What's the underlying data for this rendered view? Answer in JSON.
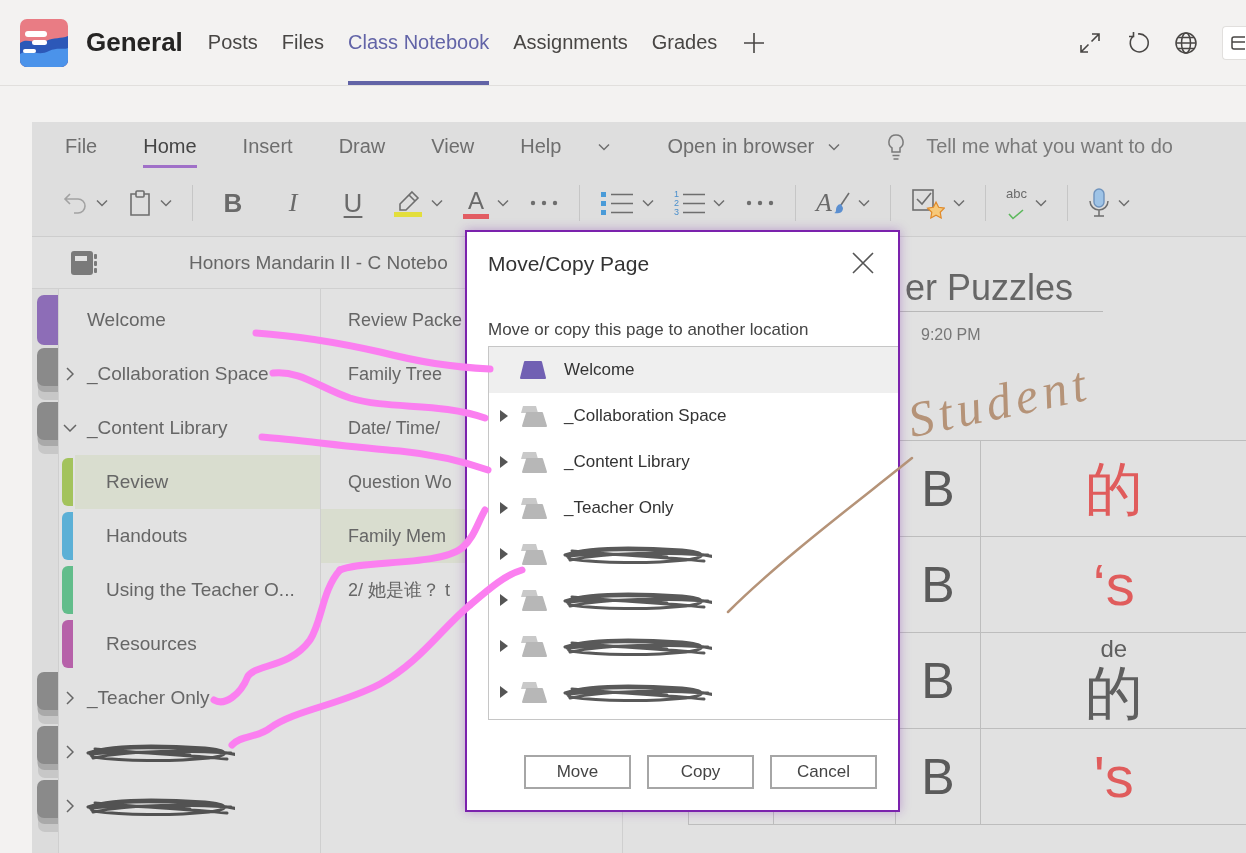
{
  "app_bar": {
    "team_name": "General",
    "tabs": [
      {
        "label": "Posts",
        "selected": false
      },
      {
        "label": "Files",
        "selected": false
      },
      {
        "label": "Class Notebook",
        "selected": true
      },
      {
        "label": "Assignments",
        "selected": false
      },
      {
        "label": "Grades",
        "selected": false
      }
    ]
  },
  "ribbon": {
    "tabs": [
      {
        "label": "File",
        "selected": false
      },
      {
        "label": "Home",
        "selected": true
      },
      {
        "label": "Insert",
        "selected": false
      },
      {
        "label": "Draw",
        "selected": false
      },
      {
        "label": "View",
        "selected": false
      },
      {
        "label": "Help",
        "selected": false
      }
    ],
    "open_in_browser": "Open in browser",
    "search": {
      "placeholder": "Tell me what you want to do"
    },
    "tools": [
      {
        "kind": "undo",
        "menu": true
      },
      {
        "kind": "paste",
        "menu": true
      },
      {
        "kind": "separator"
      },
      {
        "kind": "bold",
        "label": "B",
        "menu": false
      },
      {
        "kind": "italic",
        "label": "I",
        "menu": false
      },
      {
        "kind": "underline",
        "label": "U",
        "menu": false
      },
      {
        "kind": "highlight",
        "menu": true
      },
      {
        "kind": "font-color",
        "label": "A",
        "menu": true
      },
      {
        "kind": "more",
        "menu": false
      },
      {
        "kind": "separator"
      },
      {
        "kind": "bullets",
        "menu": true
      },
      {
        "kind": "numbering",
        "digits": [
          "1",
          "2",
          "3"
        ],
        "menu": true
      },
      {
        "kind": "more",
        "menu": false
      },
      {
        "kind": "separator"
      },
      {
        "kind": "styles",
        "label": "A",
        "menu": true
      },
      {
        "kind": "separator"
      },
      {
        "kind": "tag",
        "menu": true
      },
      {
        "kind": "separator"
      },
      {
        "kind": "spelling",
        "label": "abc",
        "menu": true
      },
      {
        "kind": "separator"
      },
      {
        "kind": "dictate",
        "menu": true
      }
    ]
  },
  "notebook": {
    "title": "Honors Mandarin II - C Notebo",
    "sections": [
      {
        "kind": "section",
        "label": "Welcome",
        "color": "#8d6db7",
        "selected": false
      },
      {
        "kind": "group",
        "label": "_Collaboration Space",
        "expanded": false,
        "redacted": false,
        "selected": false
      },
      {
        "kind": "group",
        "label": "_Content Library",
        "expanded": true,
        "redacted": false,
        "selected": false,
        "children": [
          {
            "label": "Review",
            "color": "#a3c35c",
            "selected": true
          },
          {
            "label": "Handouts",
            "color": "#5cb0d6",
            "selected": false
          },
          {
            "label": "Using the Teacher O...",
            "color": "#62bd8b",
            "selected": false
          },
          {
            "label": "Resources",
            "color": "#b661a9",
            "selected": false
          }
        ]
      },
      {
        "kind": "group",
        "label": "_Teacher Only",
        "expanded": false,
        "redacted": false,
        "selected": false
      },
      {
        "kind": "group",
        "expanded": false,
        "redacted": true,
        "selected": false
      },
      {
        "kind": "group",
        "expanded": false,
        "redacted": true,
        "selected": false
      }
    ],
    "pages": [
      {
        "label": "Review Packe",
        "selected": false
      },
      {
        "label": "Family Tree",
        "selected": false
      },
      {
        "label": "Date/ Time/",
        "selected": false
      },
      {
        "label": "Question Wo",
        "selected": false
      },
      {
        "label": "Family Mem",
        "selected": true
      },
      {
        "label": "2/ 她是谁？ t",
        "selected": false
      }
    ]
  },
  "page": {
    "title": "er Puzzles",
    "time": "9:20 PM",
    "table": {
      "rows": [
        {
          "column_3": "B",
          "column_4": "的",
          "color": "#e05c5c"
        },
        {
          "column_3": "B",
          "column_4": "‘s",
          "color": "#e05c5c"
        },
        {
          "column_3": "B",
          "column_4": "的",
          "ruby": "de",
          "color": "#5f5f5f"
        },
        {
          "column_3": "B",
          "column_4": "'s",
          "color": "#e05c5c"
        }
      ]
    }
  },
  "dialog": {
    "title": "Move/Copy Page",
    "prompt": "Move or copy this page to another location",
    "locations": [
      {
        "kind": "section",
        "label": "Welcome",
        "color": "#7160b3",
        "selected": true
      },
      {
        "kind": "group",
        "label": "_Collaboration Space",
        "expanded": false,
        "redacted": false,
        "selected": false
      },
      {
        "kind": "group",
        "label": "_Content Library",
        "expanded": false,
        "redacted": false,
        "selected": false
      },
      {
        "kind": "group",
        "label": "_Teacher Only",
        "expanded": false,
        "redacted": false,
        "selected": false
      },
      {
        "kind": "group",
        "expanded": false,
        "redacted": true,
        "selected": false
      },
      {
        "kind": "group",
        "expanded": false,
        "redacted": true,
        "selected": false
      },
      {
        "kind": "group",
        "expanded": false,
        "redacted": true,
        "selected": false
      },
      {
        "kind": "group",
        "expanded": false,
        "redacted": true,
        "selected": false
      }
    ],
    "buttons": [
      "Move",
      "Copy",
      "Cancel"
    ]
  },
  "annotations": {
    "handwritten_note": "Student"
  }
}
